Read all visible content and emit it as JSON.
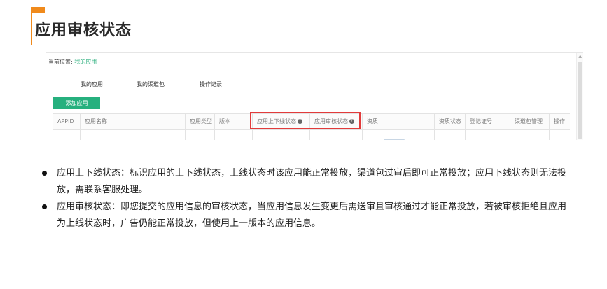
{
  "page": {
    "title": "应用审核状态"
  },
  "screenshot": {
    "breadcrumb": {
      "prefix": "当前位置:",
      "current": "我的应用"
    },
    "tabs": [
      {
        "label": "我的应用",
        "active": true
      },
      {
        "label": "我的渠道包",
        "active": false
      },
      {
        "label": "操作记录",
        "active": false
      }
    ],
    "add_button": "添加应用",
    "table": {
      "columns": [
        "APPID",
        "应用名称",
        "应用类型",
        "版本",
        "应用上下线状态",
        "应用审核状态",
        "资质",
        "资质状态",
        "登记证号",
        "渠道包管理",
        "操作"
      ],
      "help_icon": "?"
    },
    "scroll_up": "▲"
  },
  "notes": [
    {
      "text": "应用上下线状态：标识应用的上下线状态，上线状态时该应用能正常投放，渠道包过审后即可正常投放；应用下线状态则无法投放，需联系客服处理。"
    },
    {
      "text": "应用审核状态：即您提交的应用信息的审核状态，当应用信息发生变更后需送审且审核通过才能正常投放，若被审核拒绝且应用为上线状态时，广告仍能正常投放，但使用上一版本的应用信息。"
    }
  ],
  "colors": {
    "accent_orange": "#f08a1c",
    "brand_green": "#26b07e",
    "highlight_red": "#e23b3b"
  }
}
